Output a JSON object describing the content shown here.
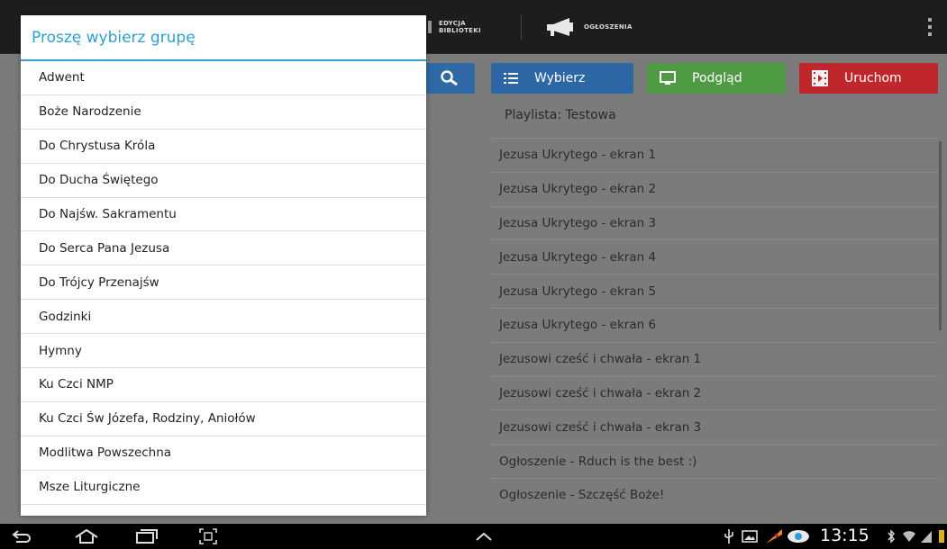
{
  "topbar": {
    "edycja_label_1": "EDYCJA",
    "edycja_label_2": "BIBLIOTEKI",
    "ogloszenia_label": "OGŁOSZENIA"
  },
  "toolbar": {
    "wybierz": "Wybierz",
    "podglad": "Podgląd",
    "uruchom": "Uruchom"
  },
  "playlist": {
    "title": "Playlista:  Testowa",
    "items": [
      "Jezusa Ukrytego - ekran 1",
      "Jezusa Ukrytego - ekran 2",
      "Jezusa Ukrytego - ekran 3",
      "Jezusa Ukrytego - ekran 4",
      "Jezusa Ukrytego - ekran 5",
      "Jezusa Ukrytego - ekran 6",
      "Jezusowi cześć i chwała - ekran 1",
      "Jezusowi cześć i chwała - ekran 2",
      "Jezusowi cześć i chwała - ekran 3",
      "Ogłoszenie - Rduch is the best :)",
      "Ogłoszenie - Szczęść Boże!"
    ]
  },
  "dialog": {
    "title": "Proszę wybierz grupę",
    "groups": [
      "Adwent",
      "Boże Narodzenie",
      "Do Chrystusa Króla",
      "Do Ducha Świętego",
      "Do Najśw. Sakramentu",
      "Do Serca Pana Jezusa",
      "Do Trójcy Przenajśw",
      "Godzinki",
      "Hymny",
      "Ku Czci NMP",
      "Ku Czci Św Józefa, Rodziny, Aniołów",
      "Modlitwa Powszechna",
      "Msze Liturgiczne"
    ]
  },
  "statusbar": {
    "clock": "13:15"
  },
  "colors": {
    "dialog_accent": "#2e9fd0",
    "wybierz": "#2c66a4",
    "podglad": "#4f9b43",
    "uruchom": "#c0272d"
  }
}
